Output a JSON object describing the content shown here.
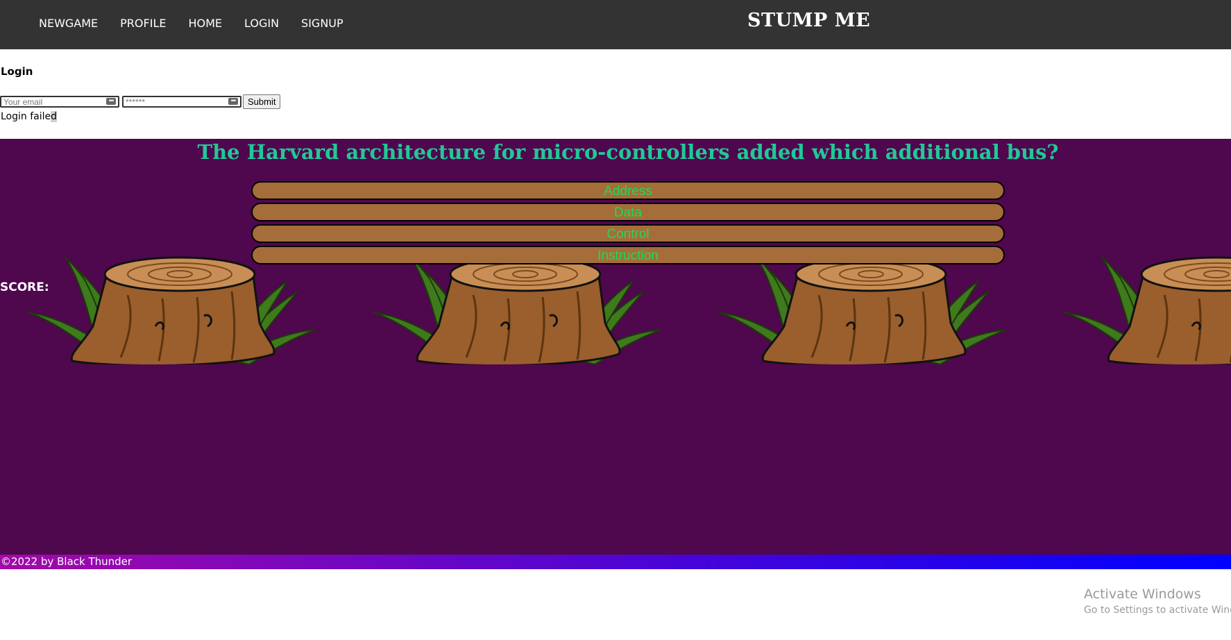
{
  "nav": {
    "links": [
      "NEWGAME",
      "PROFILE",
      "HOME",
      "LOGIN",
      "SIGNUP"
    ],
    "brand": "STUMP ME"
  },
  "login": {
    "title": "Login",
    "email_placeholder": "Your email",
    "password_placeholder": "******",
    "submit_label": "Submit",
    "status_main": "Login faile",
    "status_selected": "d"
  },
  "game": {
    "question": "The Harvard architecture for micro-controllers added which additional bus?",
    "answers": [
      "Address",
      "Data",
      "Control",
      "Instruction"
    ],
    "score_label": "SCORE:"
  },
  "footer": {
    "text": "©2022 by Black Thunder"
  },
  "os_watermark": {
    "title": "Activate Windows",
    "subtitle": "Go to Settings to activate Windows."
  },
  "colors": {
    "navbar": "#333333",
    "game_background": "#4f074d",
    "question_text": "#20c997",
    "answer_fill": "#a56d3a",
    "answer_text": "#20d957",
    "footer_gradient_start": "#a10aa6",
    "footer_gradient_end": "#0000ff"
  }
}
